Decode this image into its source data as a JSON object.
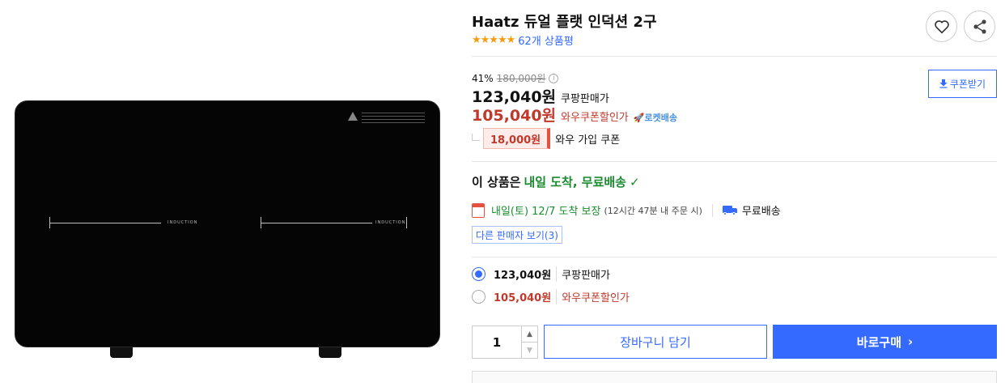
{
  "product": {
    "title": "Haatz 듀얼 플랫 인덕션 2구",
    "stars": "★★★★★",
    "review_count": "62개 상품평",
    "image": {
      "label_left": "INDUCTION",
      "label_right": "INDUCTION"
    }
  },
  "icons": {
    "wishlist": "heart-icon",
    "share": "share-icon"
  },
  "pricing": {
    "discount_rate": "41%",
    "original_price": "180,000원",
    "info_glyph": "i",
    "sale_price": "123,040원",
    "sale_label": "쿠팡판매가",
    "wow_price": "105,040원",
    "wow_label": "와우쿠폰할인가",
    "rocket_badge": "🚀로켓배송",
    "coupon_button": "쿠폰받기",
    "coupon_amount": "18,000원",
    "coupon_label": "와우 가입 쿠폰"
  },
  "delivery": {
    "headline_prefix": "이 상품은",
    "headline_highlight": "내일 도착, 무료배송",
    "check": "✓",
    "date_text": "내일(토) 12/7 도착 보장",
    "order_deadline": "(12시간 47분 내 주문 시)",
    "free_shipping": "무료배송",
    "other_sellers": "다른 판매자 보기(3)"
  },
  "options": [
    {
      "price": "123,040원",
      "label": "쿠팡판매가",
      "selected": true
    },
    {
      "price": "105,040원",
      "label": "와우쿠폰할인가",
      "selected": false
    }
  ],
  "purchase": {
    "quantity": "1",
    "up": "▲",
    "down": "▼",
    "cart_button": "장바구니 담기",
    "buy_button": "바로구매",
    "buy_chevron": "›"
  },
  "colors": {
    "accent": "#346aff",
    "sale_red": "#c0392b",
    "delivery_green": "#1b8c2f"
  }
}
